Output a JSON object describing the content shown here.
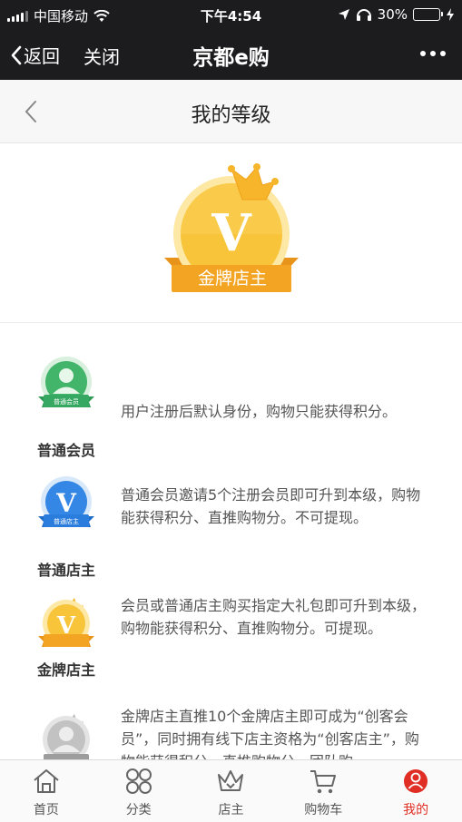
{
  "status_bar": {
    "carrier": "中国移动",
    "time": "下午4:54",
    "battery": "30%",
    "battery_level": 0.3
  },
  "navbar": {
    "back_label": "返回",
    "close_label": "关闭",
    "title": "京都e购",
    "more_icon": "more-dots-icon"
  },
  "page": {
    "title": "我的等级",
    "back_icon": "chevron-left-icon"
  },
  "current_level": {
    "badge_letter": "V",
    "name": "金牌店主",
    "color": "#f5b324"
  },
  "levels": [
    {
      "name": "普通会员",
      "badge_text": "普通会员",
      "description": "用户注册后默认身份，购物只能获得积分。",
      "color": "#3cb371"
    },
    {
      "name": "普通店主",
      "badge_text": "普通店主",
      "description": "普通会员邀请5个注册会员即可升到本级，购物能获得积分、直推购物分。不可提现。",
      "color": "#2f7fe0"
    },
    {
      "name": "金牌店主",
      "badge_text": "",
      "description": "会员或普通店主购买指定大礼包即可升到本级，购物能获得积分、直推购物分。可提现。",
      "color": "#f5b324"
    },
    {
      "name": "",
      "badge_text": "",
      "description": "金牌店主直推10个金牌店主即可成为“创客会员”，同时拥有线下店主资格为“创客店主”，购物能获得积分、直推购物分、团队购",
      "color": "#b5b5b5"
    }
  ],
  "tabbar": [
    {
      "label": "首页",
      "icon": "home-icon"
    },
    {
      "label": "分类",
      "icon": "category-icon"
    },
    {
      "label": "店主",
      "icon": "crown-icon"
    },
    {
      "label": "购物车",
      "icon": "cart-icon"
    },
    {
      "label": "我的",
      "icon": "user-icon",
      "active": true
    }
  ],
  "colors": {
    "accent": "#e02e24",
    "gold": "#f5b324",
    "dark_bar": "#1c1c1e"
  }
}
